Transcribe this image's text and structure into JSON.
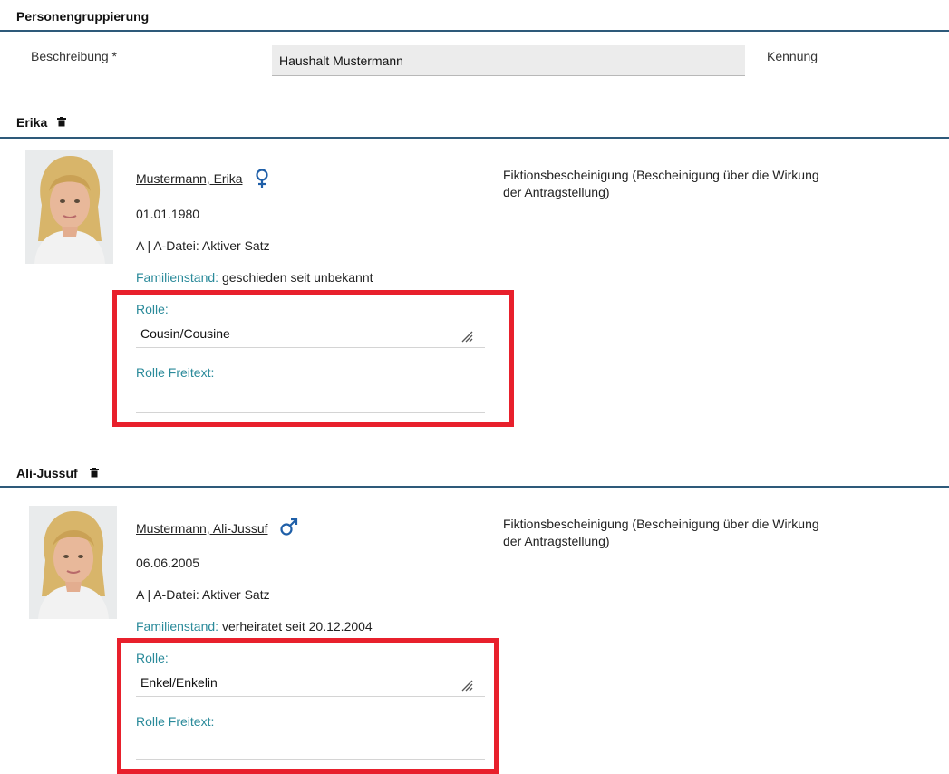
{
  "personengruppierung": {
    "title": "Personengruppierung",
    "beschreibung_label": "Beschreibung *",
    "beschreibung_value": "Haushalt Mustermann",
    "kennung_label": "Kennung"
  },
  "persons": [
    {
      "header": "Erika",
      "name": "Mustermann, Erika",
      "gender_icon": "female-icon",
      "dob": "01.01.1980",
      "status": "A | A-Datei: Aktiver Satz",
      "familienstand_label": "Familienstand:",
      "familienstand_value": "geschieden seit unbekannt",
      "rolle_label": "Rolle:",
      "rolle_value": "Cousin/Cousine",
      "rolle_freitext_label": "Rolle Freitext:",
      "document": "Fiktionsbescheinigung (Bescheinigung über die Wirkung der Antragstellung)"
    },
    {
      "header": "Ali-Jussuf",
      "name": "Mustermann, Ali-Jussuf",
      "gender_icon": "male-icon",
      "dob": "06.06.2005",
      "status": "A | A-Datei: Aktiver Satz",
      "familienstand_label": "Familienstand:",
      "familienstand_value": "verheiratet seit 20.12.2004",
      "rolle_label": "Rolle:",
      "rolle_value": "Enkel/Enkelin",
      "rolle_freitext_label": "Rolle Freitext:",
      "document": "Fiktionsbescheinigung (Bescheinigung über die Wirkung der Antragstellung)"
    }
  ],
  "colors": {
    "accent_rule": "#2e5a7a",
    "teal_label": "#2a8a9a",
    "highlight": "#e8202c"
  }
}
